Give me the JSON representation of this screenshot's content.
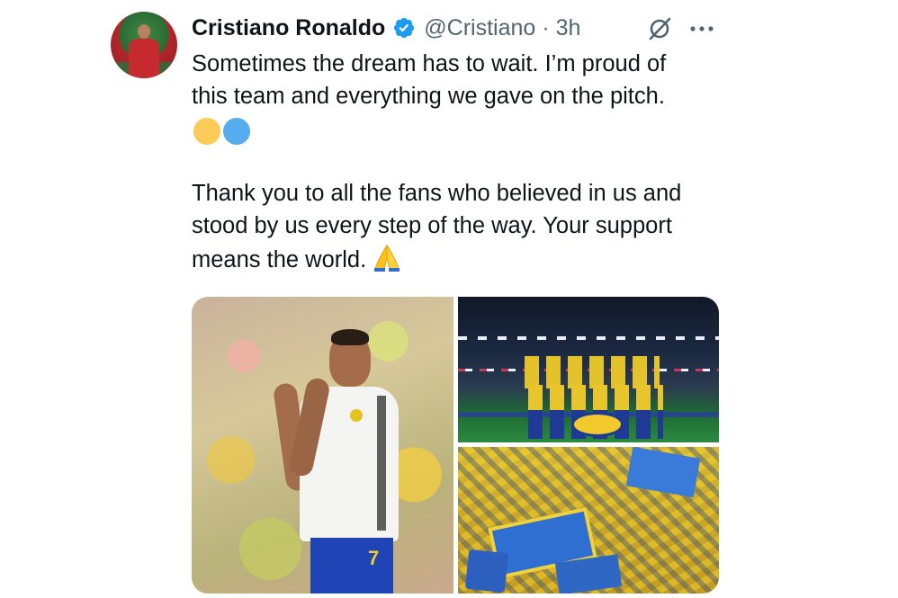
{
  "author": {
    "name": "Cristiano Ronaldo",
    "handle": "@Cristiano",
    "separator": "·",
    "time": "3h",
    "verified": true,
    "accent_color": "#1d9bf0"
  },
  "tweet": {
    "paragraph1_line1": "Sometimes the dream has to wait. I’m proud of",
    "paragraph1_line2": "this team and everything we gave on the pitch.",
    "emojis": [
      "yellow-heart",
      "blue-heart"
    ],
    "paragraph2_line1": "Thank you to all the fans who believed in us and",
    "paragraph2_line2": "stood by us every step of the way. Your support",
    "paragraph2_line3": "means the world.",
    "closing_emoji": "folded-hands"
  },
  "actions": {
    "grok_icon": "grok-icon",
    "more_icon": "more-options-icon"
  },
  "media": {
    "count": 3,
    "photos": [
      "player-applauding",
      "team-lineup",
      "fans-with-flags"
    ],
    "jersey_number": "7"
  },
  "colors": {
    "text_primary": "#0f1419",
    "text_secondary": "#536471",
    "verified_blue": "#1d9bf0"
  }
}
